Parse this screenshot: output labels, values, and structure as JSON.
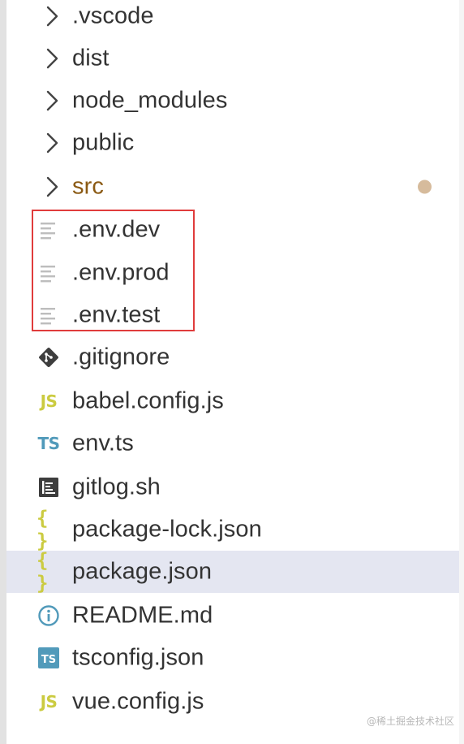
{
  "explorer": {
    "items": [
      {
        "label": ".vscode",
        "kind": "folder",
        "icon": "chevron-right-icon"
      },
      {
        "label": "dist",
        "kind": "folder",
        "icon": "chevron-right-icon"
      },
      {
        "label": "node_modules",
        "kind": "folder",
        "icon": "chevron-right-icon"
      },
      {
        "label": "public",
        "kind": "folder",
        "icon": "chevron-right-icon"
      },
      {
        "label": "src",
        "kind": "folder",
        "icon": "chevron-right-icon",
        "modified": true
      },
      {
        "label": ".env.dev",
        "kind": "file",
        "icon": "text-file-icon"
      },
      {
        "label": ".env.prod",
        "kind": "file",
        "icon": "text-file-icon"
      },
      {
        "label": ".env.test",
        "kind": "file",
        "icon": "text-file-icon"
      },
      {
        "label": ".gitignore",
        "kind": "file",
        "icon": "git-icon"
      },
      {
        "label": "babel.config.js",
        "kind": "file",
        "icon": "javascript-icon",
        "icon_text": "JS"
      },
      {
        "label": "env.ts",
        "kind": "file",
        "icon": "typescript-icon",
        "icon_text": "TS"
      },
      {
        "label": "gitlog.sh",
        "kind": "file",
        "icon": "shell-script-icon"
      },
      {
        "label": "package-lock.json",
        "kind": "file",
        "icon": "json-icon",
        "icon_text": "{ }"
      },
      {
        "label": "package.json",
        "kind": "file",
        "icon": "json-icon",
        "icon_text": "{ }",
        "selected": true
      },
      {
        "label": "README.md",
        "kind": "file",
        "icon": "info-icon"
      },
      {
        "label": "tsconfig.json",
        "kind": "file",
        "icon": "tsconfig-icon",
        "icon_text": "TS"
      },
      {
        "label": "vue.config.js",
        "kind": "file",
        "icon": "javascript-icon",
        "icon_text": "JS"
      }
    ]
  },
  "watermark": "@稀土掘金技术社区",
  "colors": {
    "label": "#333333",
    "modified_label": "#8b5a14",
    "modified_dot": "#d6bb9c",
    "selected_row": "#e4e6f1",
    "highlight_border": "#e03c3c",
    "js_icon": "#cbcb41",
    "ts_icon": "#519aba",
    "dark_icon": "#3d3d3d",
    "text_file_icon": "#bdbdbd"
  }
}
